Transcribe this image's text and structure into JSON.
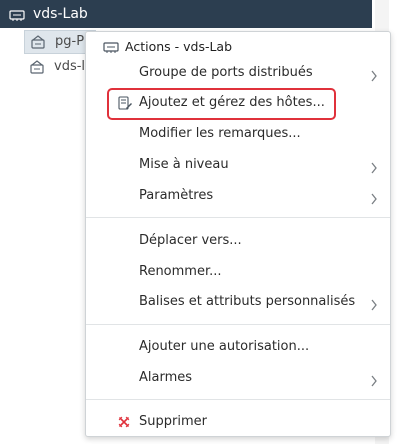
{
  "tree": {
    "selected_label": "vds-Lab",
    "items": [
      {
        "label": "pg-P"
      },
      {
        "label": "vds-l"
      }
    ]
  },
  "menu": {
    "header": "Actions - vds-Lab",
    "items": [
      {
        "label": "Groupe de ports distribués",
        "submenu": true
      },
      {
        "label": "Ajoutez et gérez des hôtes...",
        "submenu": false,
        "highlighted": true
      },
      {
        "label": "Modifier les remarques...",
        "submenu": false
      },
      {
        "label": "Mise à niveau",
        "submenu": true
      },
      {
        "label": "Paramètres",
        "submenu": true
      },
      {
        "label": "Déplacer vers...",
        "submenu": false
      },
      {
        "label": "Renommer...",
        "submenu": false
      },
      {
        "label": "Balises et attributs personnalisés",
        "submenu": true
      },
      {
        "label": "Ajouter une autorisation...",
        "submenu": false
      },
      {
        "label": "Alarmes",
        "submenu": true
      },
      {
        "label": "Supprimer",
        "submenu": false
      }
    ]
  },
  "icons": {
    "switch": "distributed-switch-icon",
    "portgroup": "port-group-icon",
    "hosts": "manage-hosts-icon",
    "chevron": "chevron-right-icon",
    "delete": "delete-x-icon"
  },
  "colors": {
    "selection_bg": "#2c3e50",
    "highlight_border": "#e0313b",
    "delete_icon": "#e0313b"
  }
}
